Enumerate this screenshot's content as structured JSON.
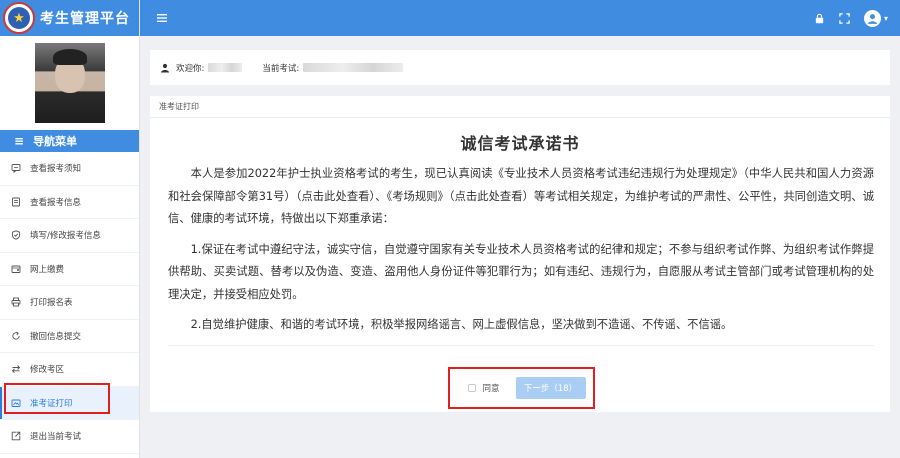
{
  "app": {
    "title": "考生管理平台"
  },
  "sidebar": {
    "nav_header": "导航菜单",
    "items": [
      {
        "label": "查看报考须知",
        "icon": "message-icon",
        "active": false
      },
      {
        "label": "查看报考信息",
        "icon": "document-icon",
        "active": false
      },
      {
        "label": "填写/修改报考信息",
        "icon": "shield-check-icon",
        "active": false
      },
      {
        "label": "网上缴费",
        "icon": "wallet-icon",
        "active": false
      },
      {
        "label": "打印报名表",
        "icon": "printer-icon",
        "active": false
      },
      {
        "label": "撤回信息提交",
        "icon": "undo-icon",
        "active": false
      },
      {
        "label": "修改考区",
        "icon": "swap-icon",
        "active": false
      },
      {
        "label": "准考证打印",
        "icon": "ticket-icon",
        "active": true
      },
      {
        "label": "退出当前考试",
        "icon": "exit-icon",
        "active": false
      }
    ]
  },
  "header": {
    "welcome_label": "欢迎你:",
    "current_exam_label": "当前考试:"
  },
  "card": {
    "breadcrumb": "准考证打印",
    "title": "诚信考试承诺书",
    "paragraphs": [
      "本人是参加2022年护士执业资格考试的考生，现已认真阅读《专业技术人员资格考试违纪违规行为处理规定》（中华人民共和国人力资源和社会保障部令第31号）（点击此处查看）、《考场规则》（点击此处查看）等考试相关规定，为维护考试的严肃性、公平性，共同创造文明、诚信、健康的考试环境，特做出以下郑重承诺：",
      "1.保证在考试中遵纪守法，诚实守信，自觉遵守国家有关专业技术人员资格考试的纪律和规定；不参与组织考试作弊、为组织考试作弊提供帮助、买卖试题、替考以及伪造、变造、盗用他人身份证件等犯罪行为；如有违纪、违规行为，自愿服从考试主管部门或考试管理机构的处理决定，并接受相应处罚。",
      "2.自觉维护健康、和谐的考试环境，积极举报网络谣言、网上虚假信息，坚决做到不造谣、不传谣、不信谣。"
    ],
    "agree_label": "同意",
    "next_button_label": "下一步（18）"
  },
  "colors": {
    "primary": "#3f8ce0",
    "active_text": "#2c7be0",
    "button_disabled": "#a9cdf3",
    "highlight": "#e02020"
  }
}
